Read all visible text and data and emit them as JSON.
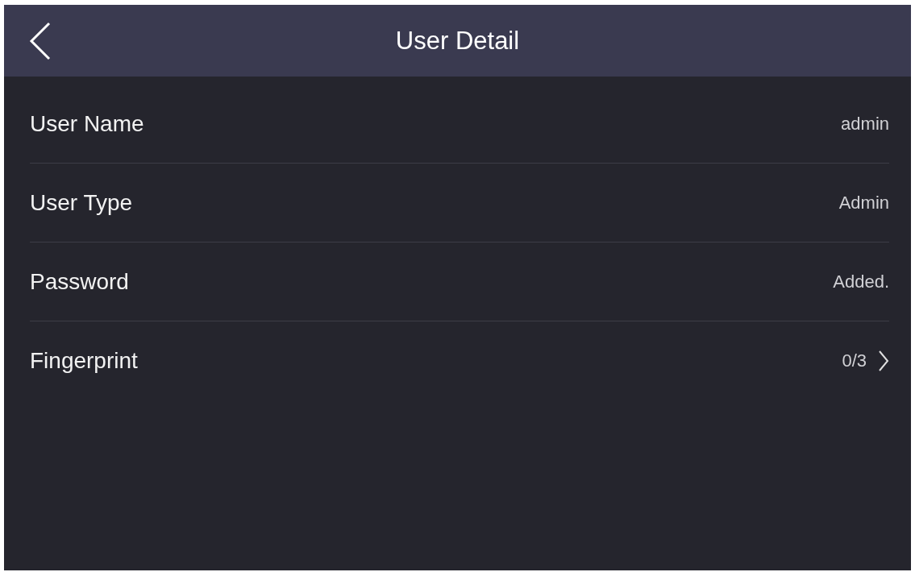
{
  "header": {
    "title": "User Detail"
  },
  "rows": [
    {
      "label": "User Name",
      "value": "admin",
      "kind": "info"
    },
    {
      "label": "User Type",
      "value": "Admin",
      "kind": "info"
    },
    {
      "label": "Password",
      "value": "Added.",
      "kind": "info"
    },
    {
      "label": "Fingerprint",
      "value": "0/3",
      "kind": "link"
    }
  ]
}
